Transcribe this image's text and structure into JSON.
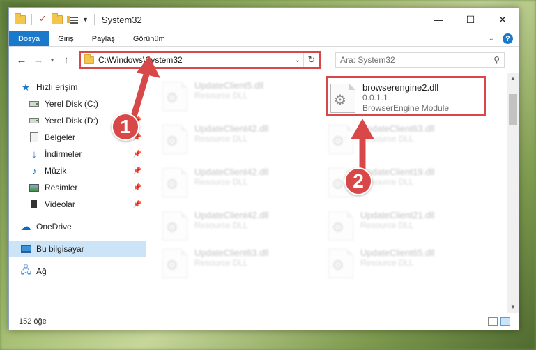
{
  "window": {
    "title": "System32",
    "controls": {
      "minimize": "—",
      "maximize": "☐",
      "close": "✕"
    }
  },
  "ribbon": {
    "tabs": [
      "Dosya",
      "Giriş",
      "Paylaş",
      "Görünüm"
    ]
  },
  "navigation": {
    "back": "←",
    "forward": "→",
    "recent": "⌄",
    "up": "↑",
    "address": "C:\\Windows\\System32",
    "search_placeholder": "Ara: System32"
  },
  "sidebar": {
    "items": [
      {
        "label": "Hızlı erişim",
        "icon": "star-icon",
        "pinned": false
      },
      {
        "label": "Yerel Disk (C:)",
        "icon": "drive-icon",
        "pinned": true
      },
      {
        "label": "Yerel Disk (D:)",
        "icon": "drive-icon",
        "pinned": true
      },
      {
        "label": "Belgeler",
        "icon": "documents-icon",
        "pinned": true
      },
      {
        "label": "İndirmeler",
        "icon": "downloads-icon",
        "pinned": true
      },
      {
        "label": "Müzik",
        "icon": "music-icon",
        "pinned": true
      },
      {
        "label": "Resimler",
        "icon": "pictures-icon",
        "pinned": true
      },
      {
        "label": "Videolar",
        "icon": "videos-icon",
        "pinned": true
      },
      {
        "label": "OneDrive",
        "icon": "onedrive-icon",
        "pinned": false
      },
      {
        "label": "Bu bilgisayar",
        "icon": "this-pc-icon",
        "pinned": false
      },
      {
        "label": "Ağ",
        "icon": "network-icon",
        "pinned": false
      }
    ]
  },
  "files": {
    "left_column": [
      {
        "name": "UpdateClient5.dll",
        "type": "Resource DLL"
      },
      {
        "name": "UpdateClient42.dll",
        "type": "Resource DLL"
      },
      {
        "name": "UpdateClient42.dll",
        "type": "Resource DLL"
      },
      {
        "name": "UpdateClient42.dll",
        "type": "Resource DLL"
      },
      {
        "name": "UpdateClient63.dll",
        "type": "Resource DLL"
      }
    ],
    "right_column": [
      {
        "name": "UpdateClient63.dll",
        "type": "Resource DLL"
      },
      {
        "name": "UpdateClient19.dll",
        "type": "Resource DLL"
      },
      {
        "name": "UpdateClient21.dll",
        "type": "Resource DLL"
      },
      {
        "name": "UpdateClient65.dll",
        "type": "Resource DLL"
      }
    ],
    "highlighted": {
      "name": "browserengine2.dll",
      "version": "0.0.1.1",
      "description": "BrowserEngine Module"
    }
  },
  "status": {
    "item_count": "152 öğe"
  },
  "annotations": {
    "step1": "1",
    "step2": "2",
    "color": "#d94848"
  }
}
